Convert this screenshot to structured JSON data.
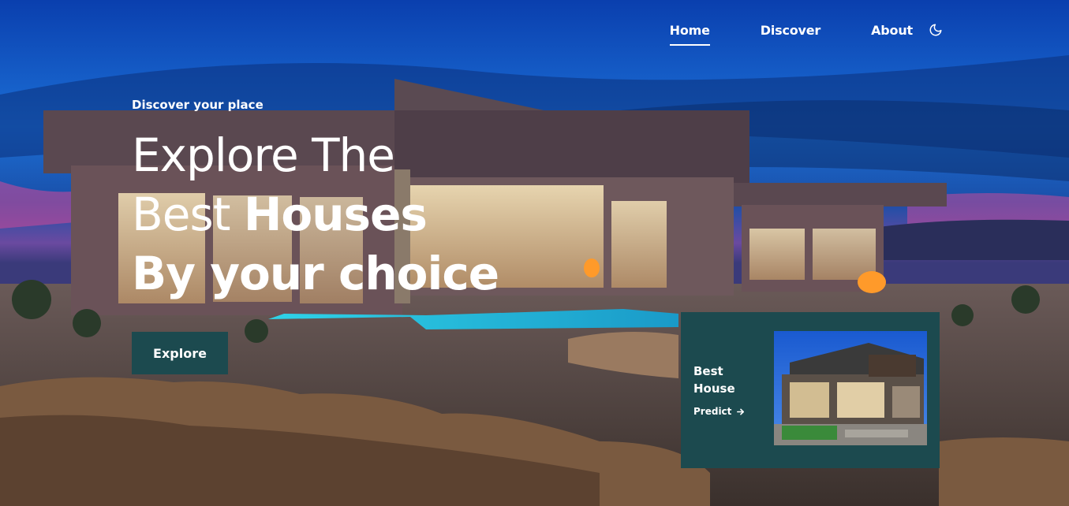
{
  "nav": {
    "items": [
      {
        "label": "Home",
        "active": true
      },
      {
        "label": "Discover",
        "active": false
      },
      {
        "label": "About",
        "active": false
      }
    ],
    "theme_icon": "moon-icon"
  },
  "hero": {
    "tagline": "Discover your place",
    "title_line1": "Explore The",
    "title_line2_thin": "Best ",
    "title_line2_bold": "Houses",
    "title_line3": "By your choice",
    "explore_label": "Explore"
  },
  "card": {
    "title": "Best House",
    "predict_label": "Predict",
    "predict_icon": "arrow-right-icon",
    "image": "modern-house-image"
  },
  "colors": {
    "accent": "#1c4a4f",
    "sky_top": "#0b3aa8",
    "sky_mid": "#1f6fd8",
    "text": "#ffffff"
  }
}
